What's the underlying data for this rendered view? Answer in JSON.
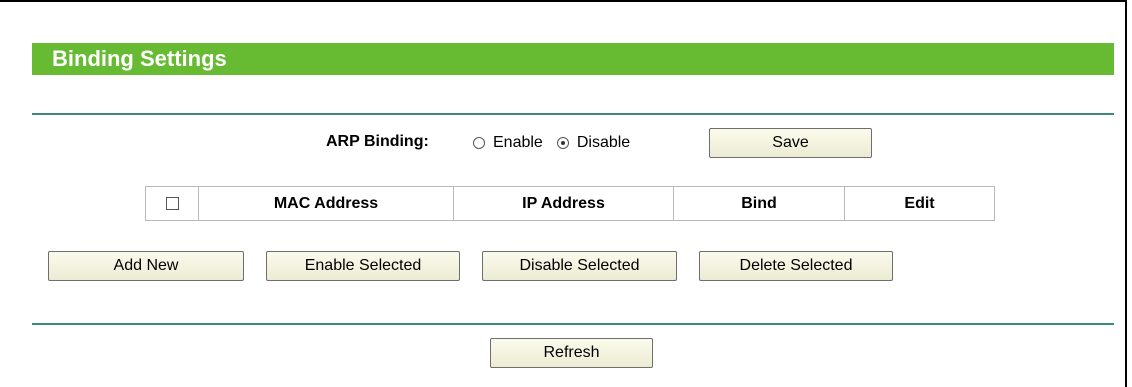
{
  "section": {
    "title": "Binding Settings"
  },
  "arp": {
    "label": "ARP Binding:",
    "options": [
      {
        "label": "Enable",
        "selected": false
      },
      {
        "label": "Disable",
        "selected": true
      }
    ],
    "save_label": "Save"
  },
  "table": {
    "columns": [
      "MAC Address",
      "IP Address",
      "Bind",
      "Edit"
    ],
    "select_all_checked": false
  },
  "actions": {
    "add_new": "Add New",
    "enable_selected": "Enable Selected",
    "disable_selected": "Disable Selected",
    "delete_selected": "Delete Selected"
  },
  "footer": {
    "refresh_label": "Refresh"
  },
  "colors": {
    "title_bar": "#66bb33",
    "divider": "#3c8a7a"
  }
}
